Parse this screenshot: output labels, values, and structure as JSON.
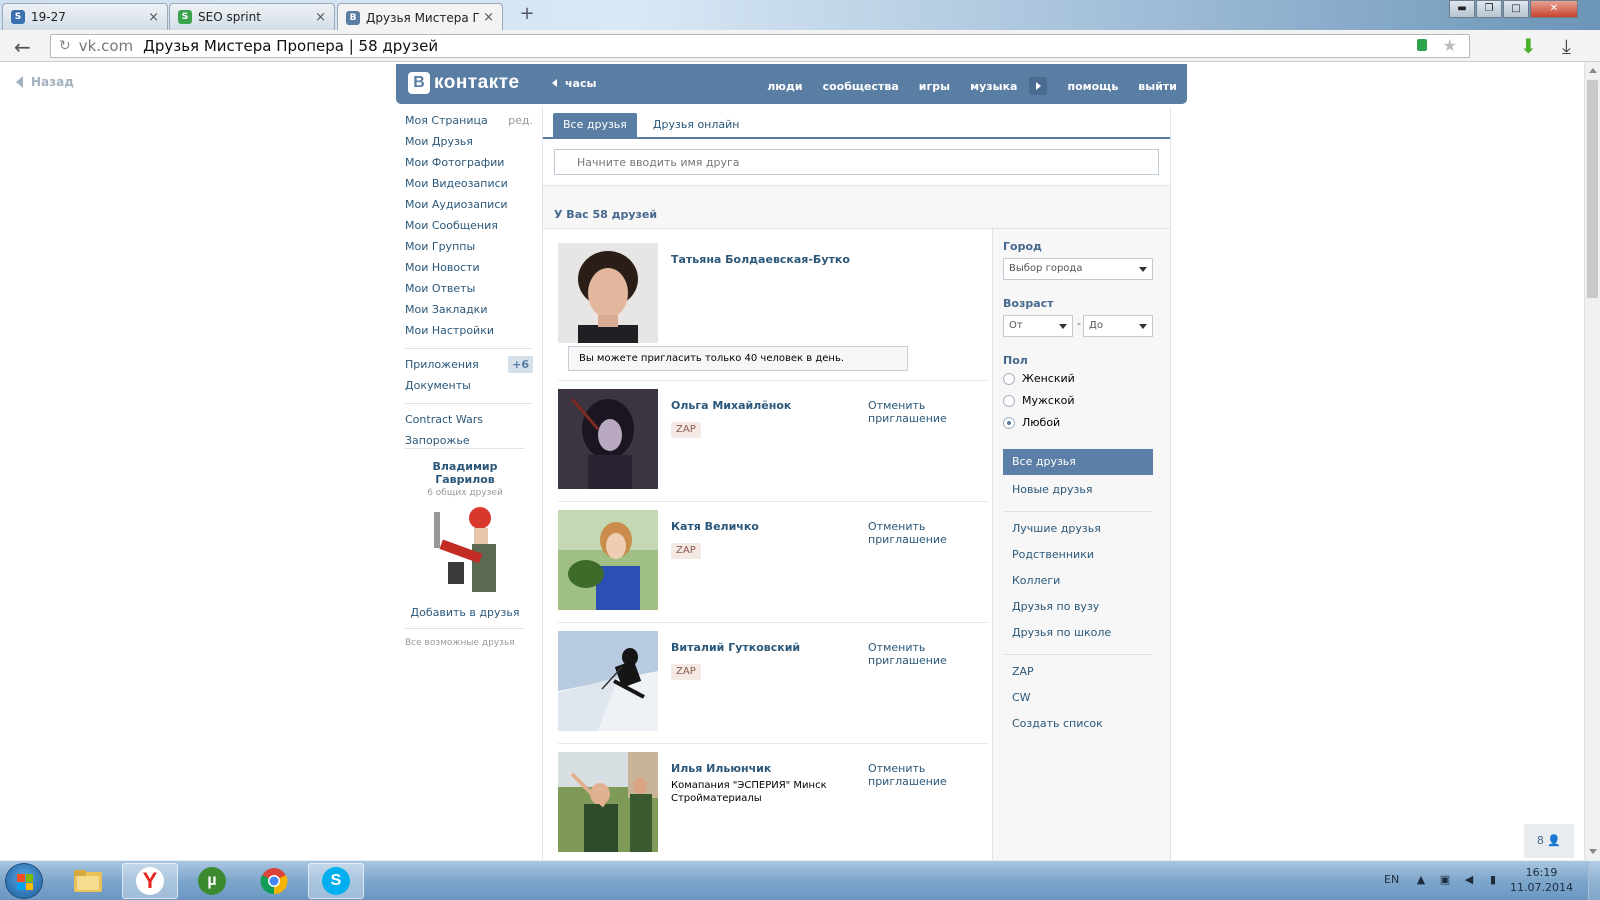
{
  "browser": {
    "tabs": [
      {
        "label": "19-27",
        "favicon": "s-icon",
        "color": "#3a6fb0"
      },
      {
        "label": "SEO sprint",
        "favicon": "seo-sprint-icon",
        "color": "#3aa34c"
      },
      {
        "label": "Друзья Мистера Проп",
        "favicon": "vk-icon",
        "color": "#597da3"
      }
    ],
    "address": {
      "domain": "vk.com",
      "title": "Друзья Мистера Пропера | 58 друзей"
    }
  },
  "page": {
    "back_label": "Назад",
    "header": {
      "logo_letter": "B",
      "logo_word": "контакте",
      "clock_label": "часы",
      "nav": [
        "люди",
        "сообщества",
        "игры",
        "музыка",
        "помощь",
        "выйти"
      ]
    },
    "left_menu": {
      "items": [
        {
          "label": "Моя Страница"
        },
        {
          "label": "Мои Друзья"
        },
        {
          "label": "Мои Фотографии"
        },
        {
          "label": "Мои Видеозаписи"
        },
        {
          "label": "Мои Аудиозаписи"
        },
        {
          "label": "Мои Сообщения"
        },
        {
          "label": "Мои Группы"
        },
        {
          "label": "Мои Новости"
        },
        {
          "label": "Мои Ответы"
        },
        {
          "label": "Мои Закладки"
        },
        {
          "label": "Мои Настройки"
        }
      ],
      "edit_label": "ред.",
      "apps_label": "Приложения",
      "apps_badge": "+6",
      "docs_label": "Документы",
      "games": [
        "Contract Wars",
        "Запорожье"
      ]
    },
    "suggestion": {
      "name": "Владимир Гаврилов",
      "common": "6 общих друзей",
      "add_label": "Добавить в друзья",
      "all_label": "Все возможные друзья"
    },
    "tabs": {
      "all": "Все друзья",
      "online": "Друзья онлайн"
    },
    "search_placeholder": "Начните вводить имя друга",
    "summary": "У Вас 58 друзей",
    "invite_note": "Вы можете пригласить только 40 человек в день.",
    "cancel_label": "Отменить приглашение",
    "friends": [
      {
        "name": "Татьяна Болдаевская-Бутко",
        "tag": "",
        "info": "",
        "cancel": false
      },
      {
        "name": "Ольга Михайлёнок",
        "tag": "ZAP",
        "info": "",
        "cancel": true
      },
      {
        "name": "Катя Величко",
        "tag": "ZAP",
        "info": "",
        "cancel": true
      },
      {
        "name": "Виталий Гутковский",
        "tag": "ZAP",
        "info": "",
        "cancel": true
      },
      {
        "name": "Илья Ильюнчик",
        "tag": "",
        "info": "Комапания \"ЭСПЕРИЯ\" Минск Стройматериалы",
        "cancel": true
      }
    ],
    "filters": {
      "city_label": "Город",
      "city_value": "Выбор города",
      "age_label": "Возраст",
      "age_from": "От",
      "age_to": "До",
      "age_dash": "-",
      "gender_label": "Пол",
      "gender_options": [
        "Женский",
        "Мужской",
        "Любой"
      ],
      "gender_selected": "Любой",
      "lists_active": "Все друзья",
      "new_friends": "Новые друзья",
      "lists": [
        "Лучшие друзья",
        "Родственники",
        "Коллеги",
        "Друзья по вузу",
        "Друзья по школе"
      ],
      "custom": [
        "ZAP",
        "CW"
      ],
      "create_list": "Создать список"
    },
    "online_counter": "8"
  },
  "taskbar": {
    "lang": "EN",
    "time": "16:19",
    "date": "11.07.2014"
  }
}
